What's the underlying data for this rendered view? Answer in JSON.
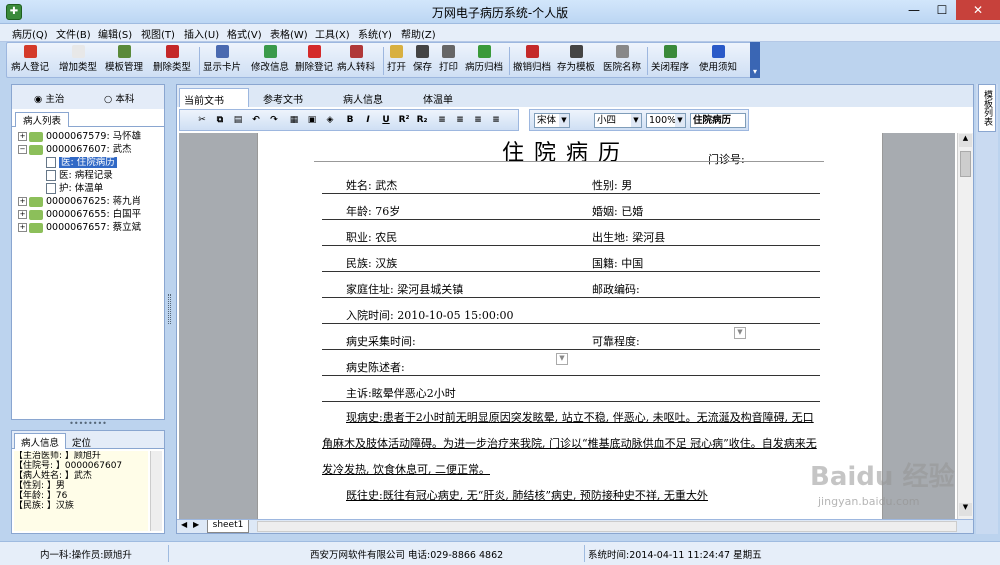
{
  "window": {
    "title": "万网电子病历系统-个人版",
    "min": "—",
    "max": "☐",
    "close": "✕"
  },
  "menu": [
    "病历(Q)",
    "文件(B)",
    "编辑(S)",
    "视图(T)",
    "插入(U)",
    "格式(V)",
    "表格(W)",
    "工具(X)",
    "系统(Y)",
    "帮助(Z)"
  ],
  "toolbar": [
    {
      "label": "病人登记",
      "icon": "add-patient-icon",
      "color": "#d43a2a"
    },
    {
      "label": "增加类型",
      "icon": "add-type-icon",
      "color": "#e8e8e8"
    },
    {
      "label": "模板管理",
      "icon": "template-icon",
      "color": "#5a8a3a"
    },
    {
      "label": "删除类型",
      "icon": "delete-type-icon",
      "color": "#c42828"
    },
    {
      "label": "显示卡片",
      "icon": "card-icon",
      "color": "#4a6ab0"
    },
    {
      "label": "修改信息",
      "icon": "edit-info-icon",
      "color": "#3a9a4a"
    },
    {
      "label": "删除登记",
      "icon": "delete-record-icon",
      "color": "#d42a2a"
    },
    {
      "label": "病人转科",
      "icon": "transfer-icon",
      "color": "#b03838"
    },
    {
      "label": "打开",
      "icon": "open-folder-icon",
      "color": "#d8b040"
    },
    {
      "label": "保存",
      "icon": "save-icon",
      "color": "#444444"
    },
    {
      "label": "打印",
      "icon": "print-icon",
      "color": "#666666"
    },
    {
      "label": "病历归档",
      "icon": "archive-icon",
      "color": "#3a9a3a"
    },
    {
      "label": "撤销归档",
      "icon": "undo-archive-icon",
      "color": "#c42a2a"
    },
    {
      "label": "存为模板",
      "icon": "save-template-icon",
      "color": "#444444"
    },
    {
      "label": "医院名称",
      "icon": "key-icon",
      "color": "#888888"
    },
    {
      "label": "关闭程序",
      "icon": "exit-icon",
      "color": "#3a8a3a"
    },
    {
      "label": "使用须知",
      "icon": "help-icon",
      "color": "#2a5ac8"
    }
  ],
  "left": {
    "radio1": "主治",
    "radio2": "本科",
    "tab": "病人列表",
    "tree": [
      {
        "label": "0000067579: 马怀雄",
        "kind": "patient",
        "exp": "+"
      },
      {
        "label": "0000067607: 武杰",
        "kind": "patient",
        "exp": "−"
      },
      {
        "label": "医: 住院病历",
        "kind": "doc",
        "selected": true
      },
      {
        "label": "医: 病程记录",
        "kind": "doc"
      },
      {
        "label": "护: 体温单",
        "kind": "doc"
      },
      {
        "label": "0000067625: 蒋九肖",
        "kind": "patient",
        "exp": "+"
      },
      {
        "label": "0000067655: 白国平",
        "kind": "patient",
        "exp": "+"
      },
      {
        "label": "0000067657: 蔡立斌",
        "kind": "patient",
        "exp": "+"
      }
    ],
    "splitter": "••••••••",
    "info_tabs": [
      "病人信息",
      "定位"
    ],
    "info_lines": [
      "【主治医师: 】顾旭升",
      "【住院号: 】0000067607",
      "【病人姓名: 】武杰",
      "【性别: 】男",
      "【年龄: 】76",
      "【民族: 】汉族"
    ]
  },
  "doc": {
    "tabs": [
      "当前文书",
      "参考文书",
      "病人信息",
      "体温单"
    ],
    "font": "宋体",
    "size": "小四",
    "zoom": "100%",
    "doc_name": "住院病历",
    "title": "住院病历",
    "fields": {
      "outpatient": "门诊号:",
      "name": "姓名:  武杰",
      "sex": "性别:  男",
      "age": "年龄:  76岁",
      "marital": "婚姻:  已婚",
      "job": "职业:  农民",
      "birthplace": "出生地:  梁河县",
      "ethnic": "民族:  汉族",
      "nation": "国籍:  中国",
      "address": "家庭住址:  梁河县城关镇",
      "postcode": "邮政编码:",
      "admit": "入院时间:  2010-10-05 15:00:00",
      "history_time": "病史采集时间:",
      "reliability": "可靠程度:",
      "narrator": "病史陈述者:",
      "complaint": "主诉:眩晕伴恶心2小时",
      "present": "现病史:患者于2小时前无明显原因突发眩晕, 站立不稳, 伴恶心, 未呕吐。无流涎及构音障碍, 无口角麻木及肢体活动障碍。为进一步治疗来我院, 门诊以“椎基底动脉供血不足 冠心病”收住。自发病来无发冷发热, 饮食休息可, 二便正常。",
      "past": "既往史:既往有冠心病史, 无“肝炎, 肺结核”病史, 预防接种史不祥, 无重大外"
    },
    "sheet": "sheet1",
    "side_tab": "模板列表"
  },
  "status": {
    "operator": "内一科:操作员:顾旭升",
    "company": "西安万网软件有限公司 电话:029-8866 4862",
    "time": "系统时间:2014-04-11 11:24:47 星期五"
  },
  "watermark": {
    "main": "Baidu 经验",
    "sub": "jingyan.baidu.com"
  }
}
